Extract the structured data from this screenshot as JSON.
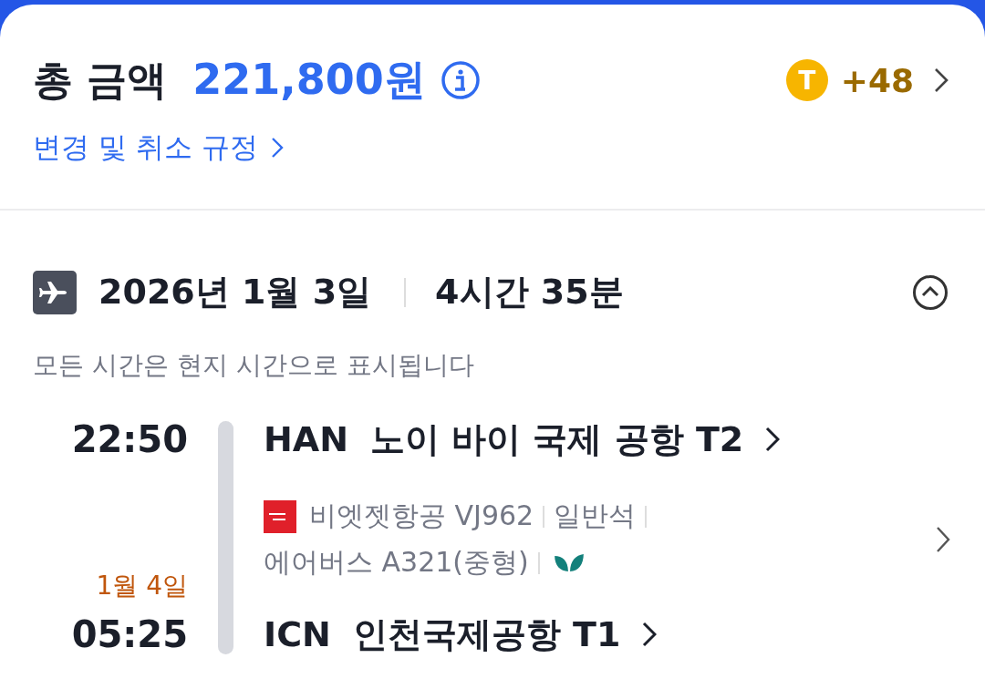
{
  "total": {
    "label": "총 금액",
    "amount": "221,800원"
  },
  "points": {
    "coin": "T",
    "amount": "+48"
  },
  "policy_link": "변경 및 취소 규정",
  "flight": {
    "date": "2026년 1월 3일",
    "duration": "4시간 35분",
    "expanded": true,
    "note": "모든 시간은 현지 시간으로 표시됩니다",
    "departure": {
      "time": "22:50",
      "code": "HAN",
      "airport": "노이 바이 국제 공항 T2"
    },
    "details": {
      "airline": "비엣젯항공 VJ962",
      "cabin": "일반석",
      "aircraft": "에어버스 A321(중형)",
      "eco": true
    },
    "arrival": {
      "date": "1월 4일",
      "time": "05:25",
      "code": "ICN",
      "airport": "인천국제공항 T1"
    }
  }
}
